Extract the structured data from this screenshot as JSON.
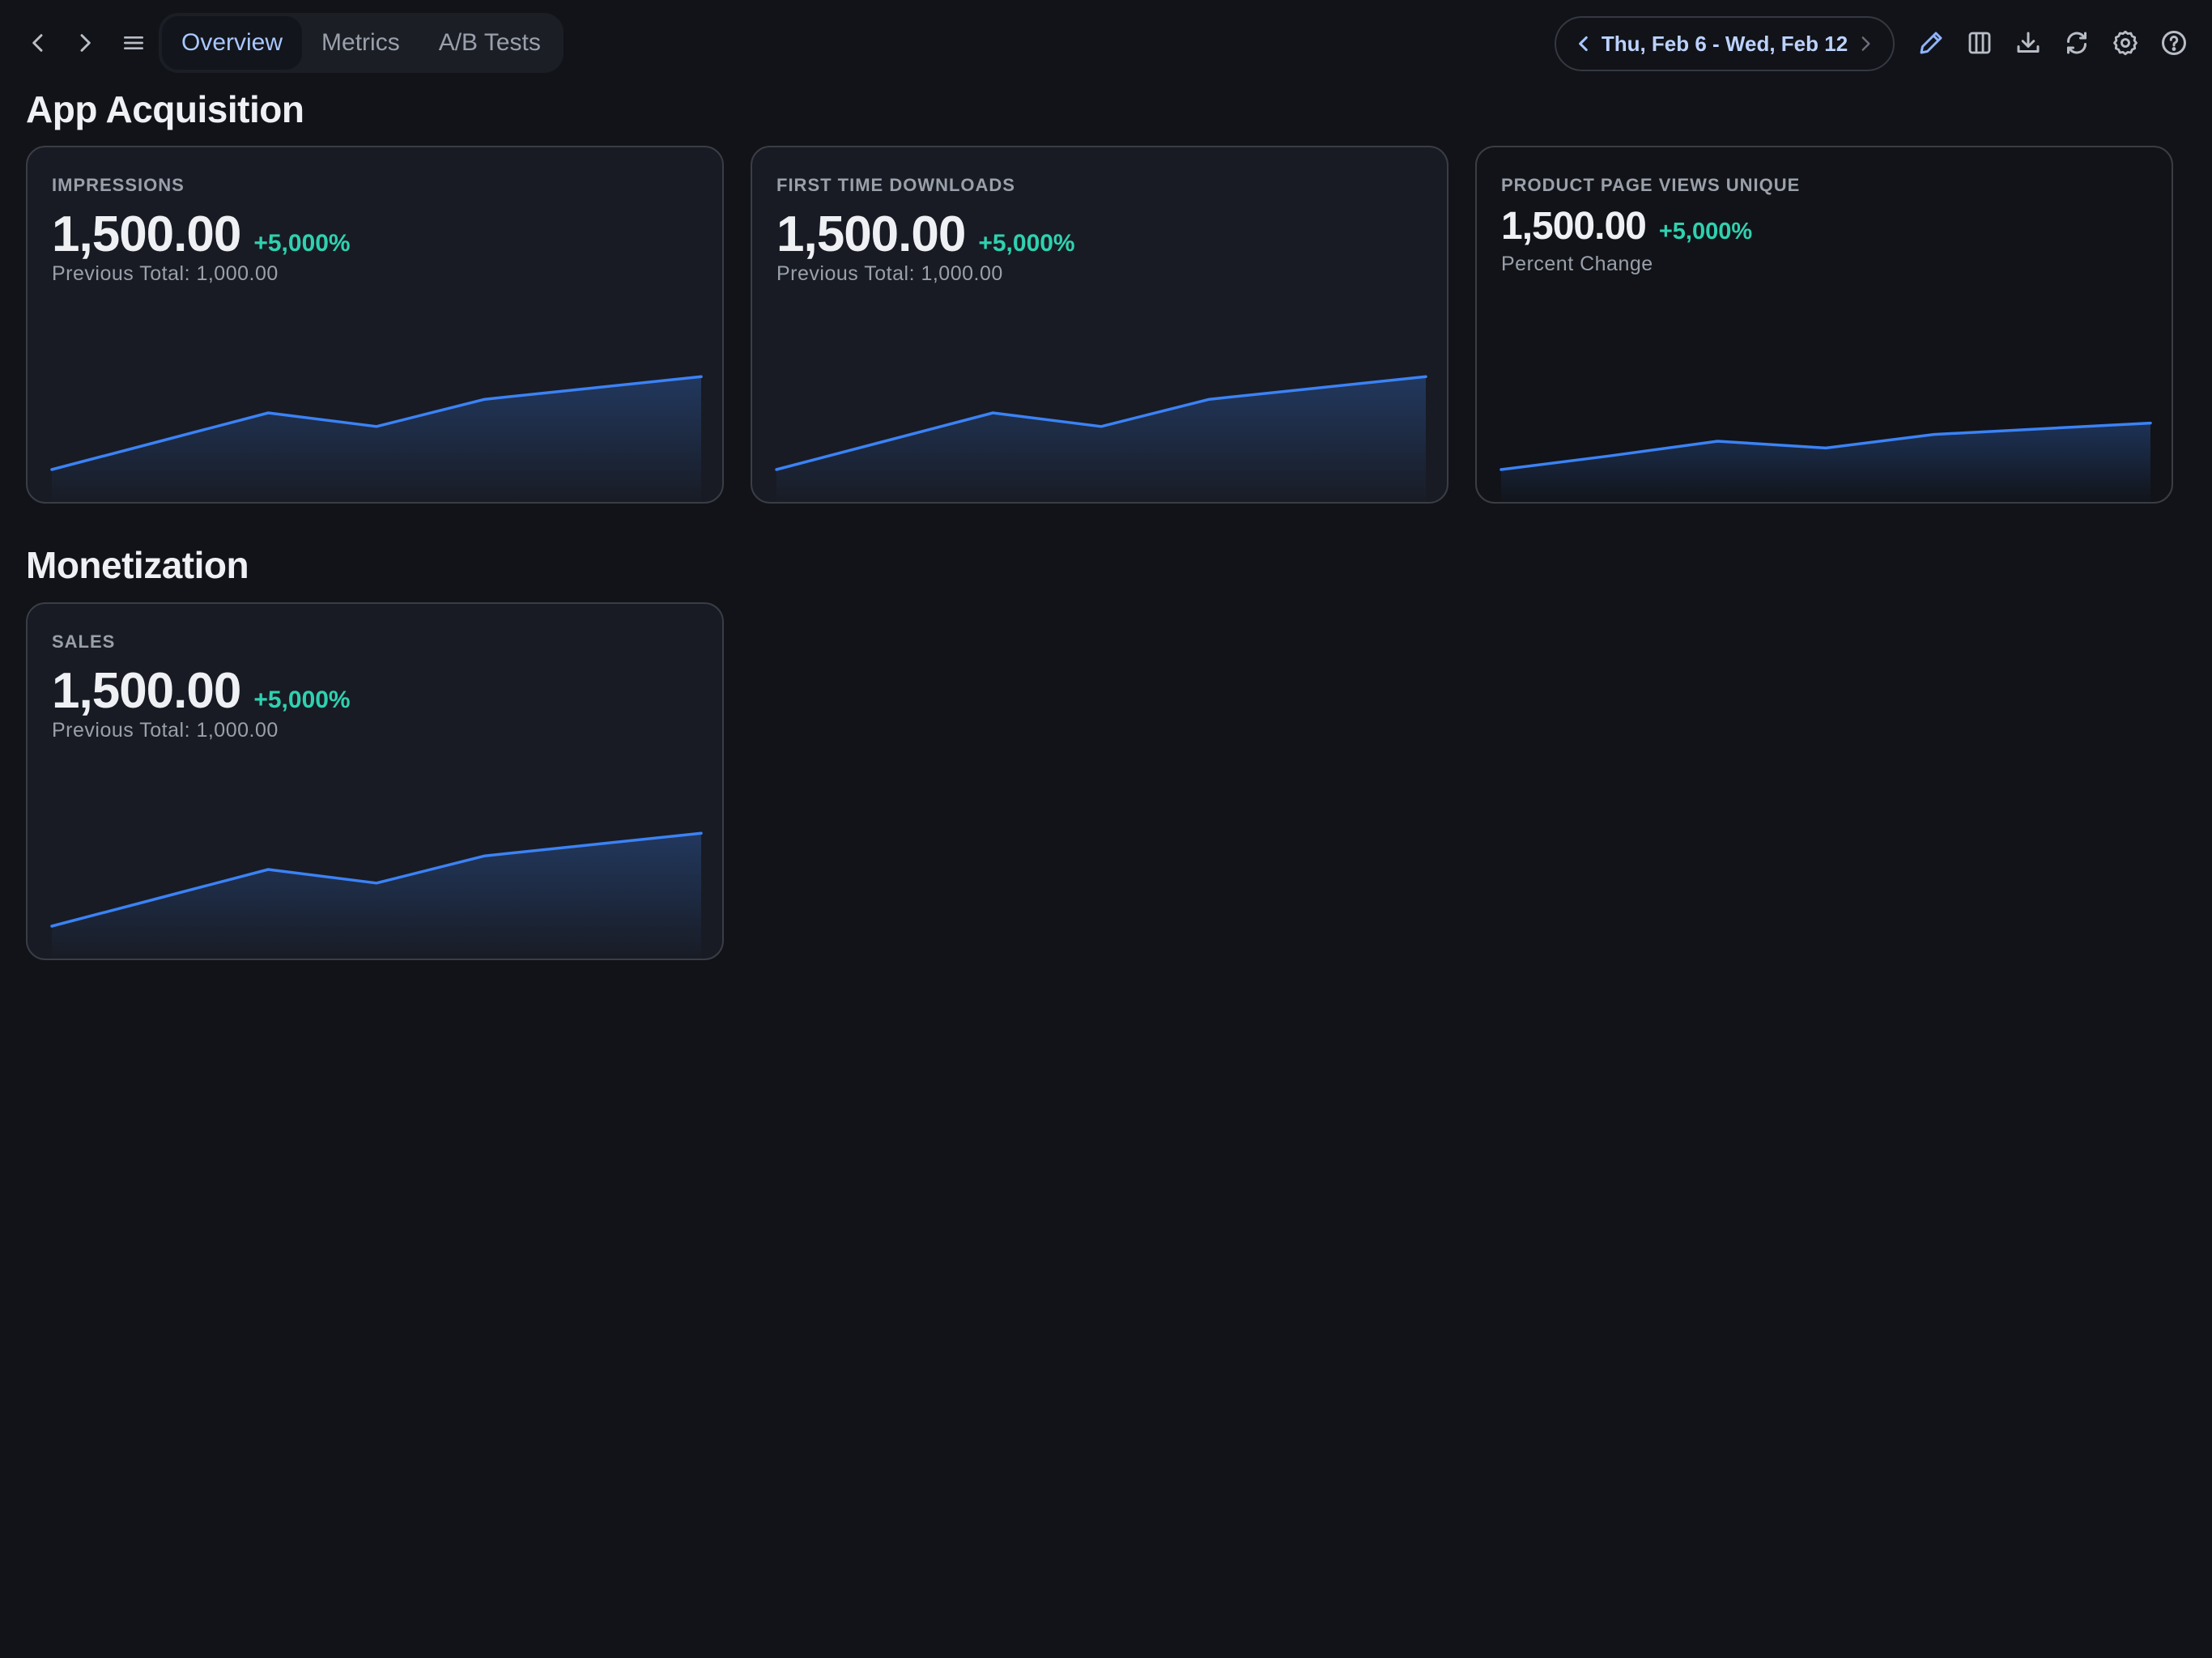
{
  "toolbar": {
    "tabs": [
      {
        "label": "Overview",
        "active": true
      },
      {
        "label": "Metrics",
        "active": false
      },
      {
        "label": "A/B Tests",
        "active": false
      }
    ],
    "date_range": "Thu, Feb 6 - Wed, Feb 12",
    "icons": [
      "chevron-left-icon",
      "chevron-right-icon",
      "menu-icon",
      "pencil-icon",
      "columns-icon",
      "download-icon",
      "refresh-icon",
      "gear-icon",
      "help-icon"
    ]
  },
  "sections": [
    {
      "title": "App Acquisition",
      "cards": [
        {
          "name": "IMPRESSIONS",
          "value": "1,500.00",
          "delta": "+5,000%",
          "sub": "Previous Total: 1,000.00",
          "trend": [
            0,
            0.25,
            0.5,
            0.38,
            0.62,
            0.72,
            0.82
          ]
        },
        {
          "name": "FIRST TIME DOWNLOADS",
          "value": "1,500.00",
          "delta": "+5,000%",
          "sub": "Previous Total: 1,000.00",
          "trend": [
            0,
            0.25,
            0.5,
            0.38,
            0.62,
            0.72,
            0.82
          ]
        },
        {
          "name": "PRODUCT PAGE VIEWS UNIQUE",
          "value": "1,500.00",
          "delta": "+5,000%",
          "sub": "Percent Change",
          "trend": [
            0,
            0.12,
            0.25,
            0.19,
            0.31,
            0.36,
            0.41
          ]
        }
      ]
    },
    {
      "title": "Monetization",
      "cards": [
        {
          "name": "SALES",
          "value": "1,500.00",
          "delta": "+5,000%",
          "sub": "Previous Total: 1,000.00",
          "trend": [
            0,
            0.25,
            0.5,
            0.38,
            0.62,
            0.72,
            0.82
          ]
        }
      ]
    }
  ],
  "colors": {
    "background": "#111318",
    "card": "#181b23",
    "accent": "#3b82f6",
    "positive": "#2fd1b0",
    "tab_active_text": "#a9c7ff"
  }
}
